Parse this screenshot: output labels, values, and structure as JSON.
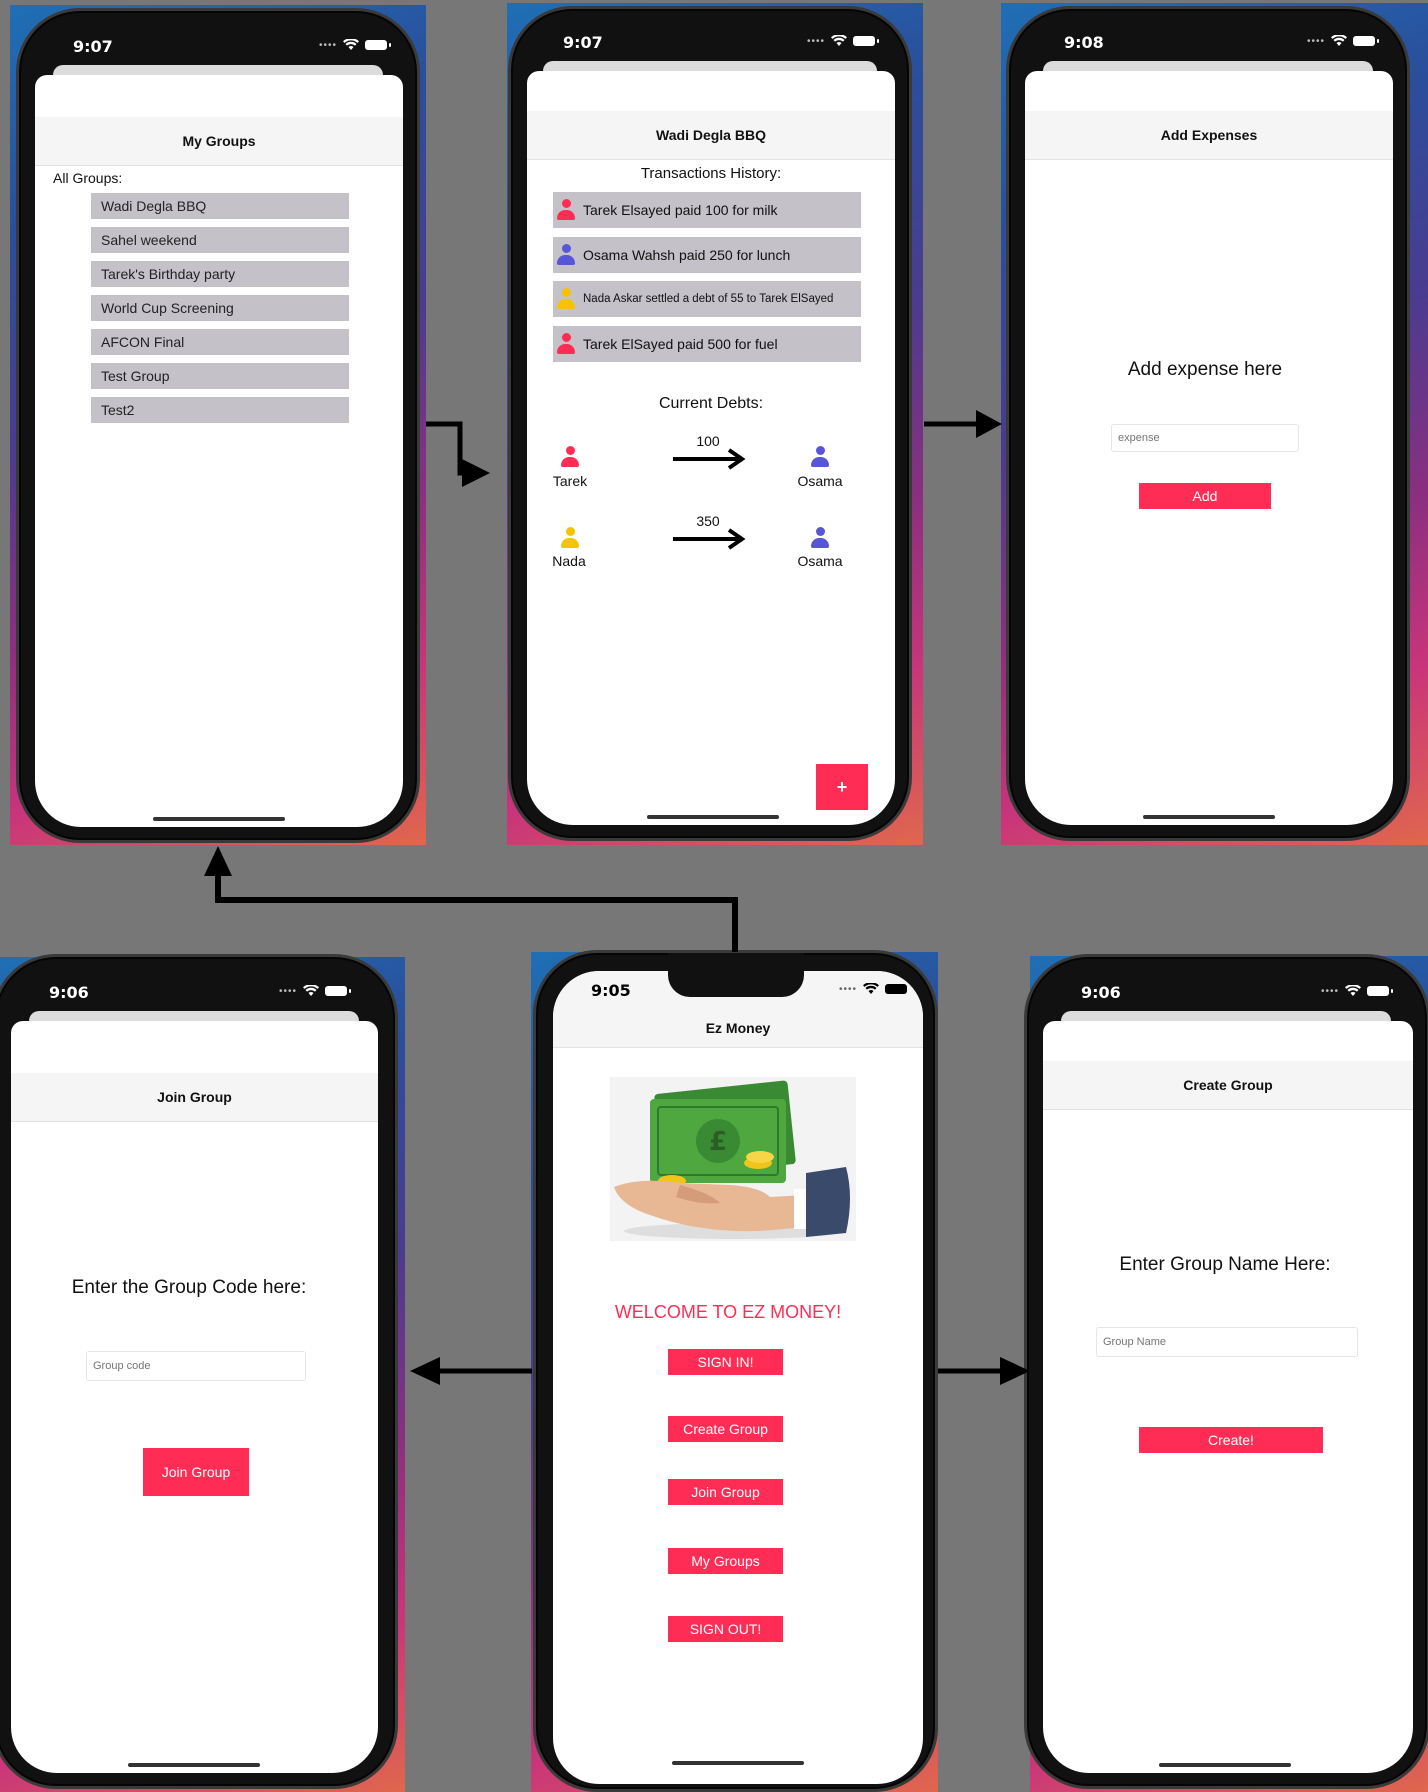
{
  "colors": {
    "accent": "#ff2d55",
    "row_bg": "#c4c1c9",
    "red_user": "#ff2d55",
    "blue_user": "#5856d6",
    "yellow_user": "#f5c400"
  },
  "my_groups": {
    "time": "9:07",
    "title": "My Groups",
    "all_groups_label": "All Groups:",
    "groups": [
      "Wadi Degla BBQ",
      "Sahel weekend",
      "Tarek's Birthday party",
      "World Cup Screening",
      "AFCON Final",
      "Test Group",
      "Test2"
    ]
  },
  "group_detail": {
    "time": "9:07",
    "title": "Wadi Degla BBQ",
    "history_label": "Transactions History:",
    "transactions": [
      {
        "text": "Tarek Elsayed paid 100 for milk",
        "color": "red"
      },
      {
        "text": "Osama Wahsh paid 250 for lunch",
        "color": "blue"
      },
      {
        "text": "Nada Askar settled a debt of 55 to Tarek ElSayed",
        "color": "yellow"
      },
      {
        "text": "Tarek ElSayed paid 500 for fuel",
        "color": "red"
      }
    ],
    "debts_label": "Current Debts:",
    "debts": [
      {
        "from": "Tarek",
        "from_color": "red",
        "amount": "100",
        "to": "Osama",
        "to_color": "blue"
      },
      {
        "from": "Nada",
        "from_color": "yellow",
        "amount": "350",
        "to": "Osama",
        "to_color": "blue"
      }
    ],
    "fab_label": "+"
  },
  "add_expense": {
    "time": "9:08",
    "title": "Add Expenses",
    "heading": "Add expense here",
    "placeholder": "expense",
    "button": "Add"
  },
  "join_group": {
    "time": "9:06",
    "title": "Join Group",
    "heading": "Enter the Group Code here:",
    "placeholder": "Group code",
    "button": "Join Group"
  },
  "home": {
    "time": "9:05",
    "title": "Ez Money",
    "welcome": "WELCOME TO EZ MONEY!",
    "buttons": [
      "SIGN IN!",
      "Create Group",
      "Join Group",
      "My Groups",
      "SIGN OUT!"
    ]
  },
  "create_group": {
    "time": "9:06",
    "title": "Create Group",
    "heading": "Enter Group Name Here:",
    "placeholder": "Group Name",
    "button": "Create!"
  }
}
